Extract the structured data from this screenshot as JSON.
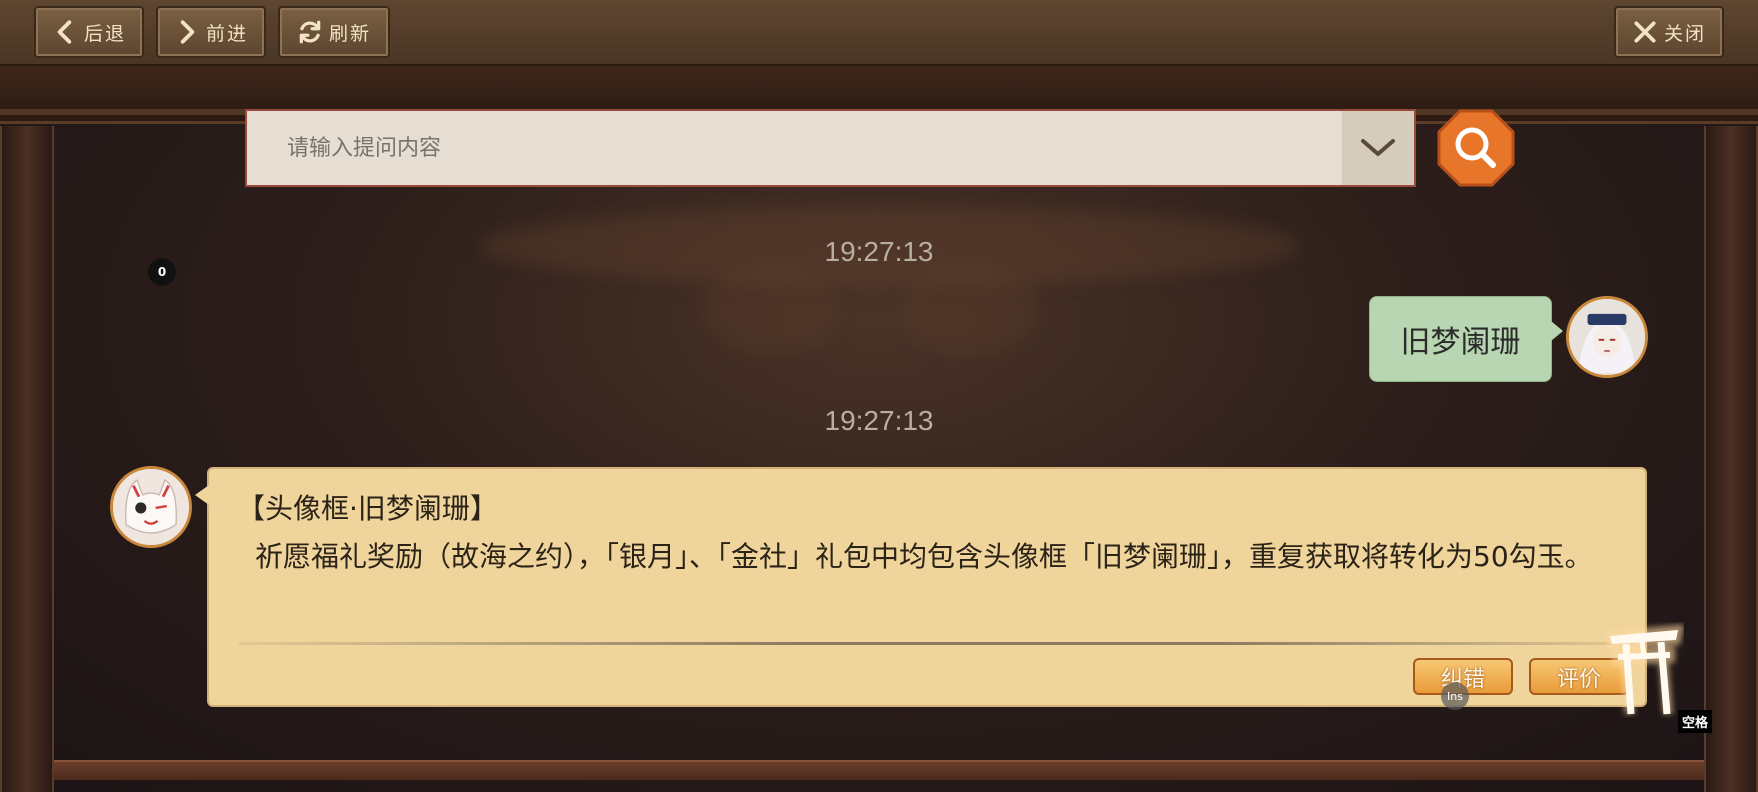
{
  "toolbar": {
    "back_label": "后退",
    "forward_label": "前进",
    "refresh_label": "刷新",
    "close_label": "关闭"
  },
  "search": {
    "placeholder": "请输入提问内容",
    "dropdown_icon": "chevron-down-icon",
    "search_icon": "magnifier-icon"
  },
  "badge": {
    "count": "0"
  },
  "chat": {
    "messages": [
      {
        "time": "19:27:13",
        "from": "user",
        "text": "旧梦阑珊"
      },
      {
        "time": "19:27:13",
        "from": "bot",
        "title": "【头像框·旧梦阑珊】",
        "body": "祈愿福礼奖励（故海之约），「银月」、「金社」礼包中均包含头像框「旧梦阑珊」，重复获取将转化为50勾玉。",
        "actions": {
          "correct_label": "纠错",
          "rate_label": "评价"
        }
      }
    ]
  },
  "hints": {
    "ins": "Ins",
    "space": "空格"
  },
  "colors": {
    "toolbar_bg": "#5e4630",
    "user_bubble": "#b7d6b1",
    "bot_bubble": "#efd49c",
    "search_button": "#e8762a",
    "action_button": "#f2b45a"
  }
}
